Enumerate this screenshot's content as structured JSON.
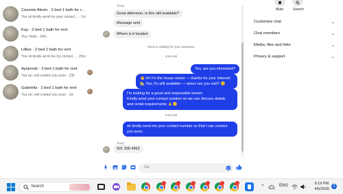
{
  "conversations": [
    {
      "name": "Cavonte Alexis · 2 bed 1 bath for r...",
      "preview": "You ok kindly send my your contact... · 1m"
    },
    {
      "name": "Kay · 2 bed 1 bath for rent",
      "preview": "You: Hello · 24m"
    },
    {
      "name": "Lilliee · 2 bed 1 bath for rent",
      "preview": "You ok kindly send me my contact... · 25m"
    },
    {
      "name": "Ayiannah · 2 bed 1 bath for rent",
      "preview": "You ok i will contact you soon · 23h"
    },
    {
      "name": "Gabriella · 2 bed 1 bath for rent",
      "preview": "You ok i will contact you soon · 1d"
    }
  ],
  "chat": {
    "sender_top": "Torey",
    "messages_in_1": "Good afternoon, is this still available?",
    "messages_in_2": "Message sent",
    "messages_in_3": "Where is it located",
    "waiting": "Torey is waiting for your response.",
    "time_1": "6:44 AM",
    "out_1": "Yes, are you interested?",
    "out_2_line1": "👋 Hi! I'm the house owner — thanks for your interest!",
    "out_2_line2": "🏡 Yes, it's still available — when can you visit? 😊",
    "out_3_line1": "I'm looking for a good and responsible tenant.",
    "out_3_line2": "Kindly send your contact number so we can discuss details",
    "out_3_line3": "and rental requirements 🙏😊",
    "time_2": "8:43 AM",
    "out_4_line1": "ok  kindly send me your contact number so that I can contact",
    "out_4_line2": "you soon.",
    "sender_bottom": "Torey",
    "in_4": "501 300 4962",
    "composer_placeholder": "Aa"
  },
  "details": {
    "mute_label": "Mute",
    "search_label": "Search",
    "rows": [
      "Customize chat",
      "Chat members",
      "Media, files and links",
      "Privacy & support"
    ]
  },
  "taskbar": {
    "search_label": "Search",
    "lang": "ENG",
    "time": "9:19 PM",
    "date": "4/6/2026",
    "notif_count": "3"
  },
  "colors": {
    "accent": "#1f3ee8",
    "icon_blue": "#2f6fea"
  }
}
